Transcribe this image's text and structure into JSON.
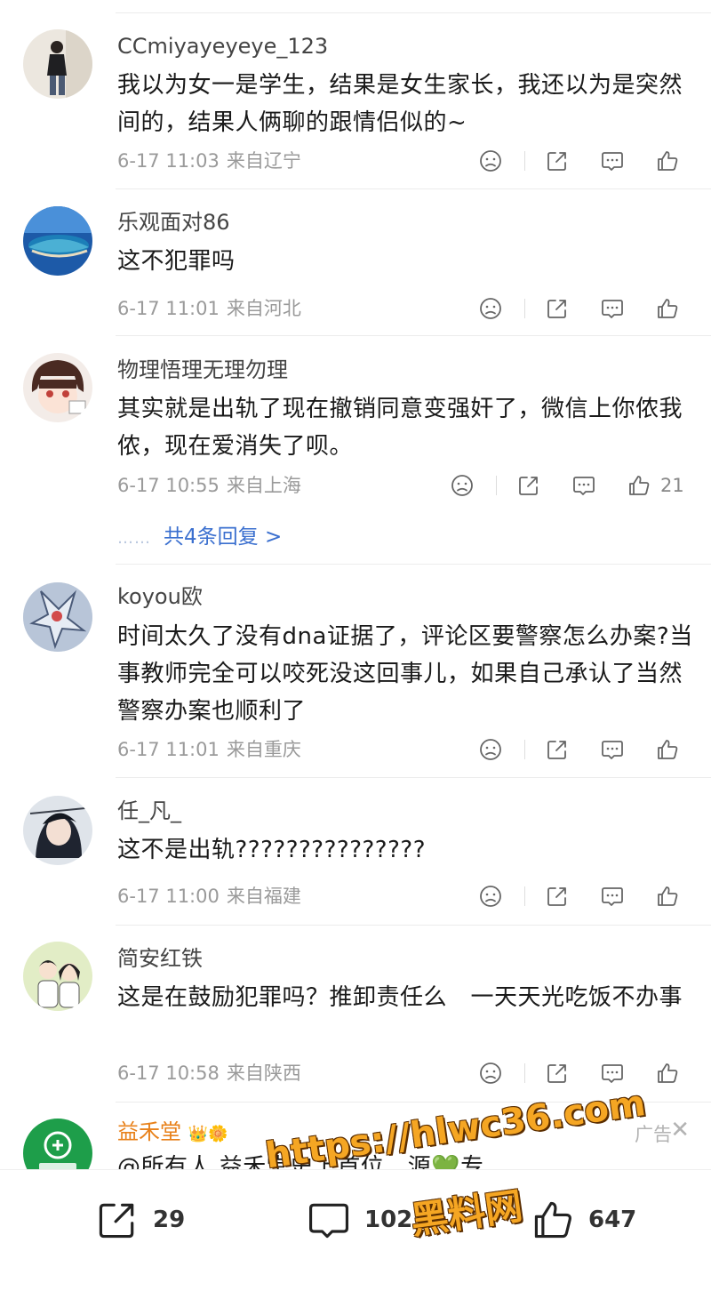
{
  "comments": [
    {
      "username": "CCmiyayeyeye_123",
      "text": "我以为女一是学生，结果是女生家长，我还以为是突然间的，结果人俩聊的跟情侣似的~",
      "time": "6-17 11:03",
      "location": "来自辽宁"
    },
    {
      "username": "乐观面对86",
      "text": "这不犯罪吗",
      "time": "6-17 11:01",
      "location": "来自河北"
    },
    {
      "username": "物理悟理无理勿理",
      "text": "其实就是出轨了现在撤销同意变强奸了，微信上你侬我侬，现在爱消失了呗。",
      "time": "6-17 10:55",
      "location": "来自上海",
      "likes": "21",
      "replies_dots": "……",
      "replies_label": "共4条回复 >"
    },
    {
      "username": "koyou欧",
      "text": "时间太久了没有dna证据了，评论区要警察怎么办案?当事教师完全可以咬死没这回事儿，如果自己承认了当然警察办案也顺利了",
      "time": "6-17 11:01",
      "location": "来自重庆"
    },
    {
      "username": "任_凡_",
      "text": "这不是出轨???????????????",
      "time": "6-17 11:00",
      "location": "来自福建"
    },
    {
      "username": "简安红铁",
      "text": "这是在鼓励犯罪吗？推卸责任么　一天天光吃饭不办事",
      "time": "6-17 10:58",
      "location": "来自陕西"
    }
  ],
  "ad": {
    "username": "益禾堂",
    "badges": "👑🌼",
    "text": "@所有人 益禾堂史上首位…源💚专",
    "tag": "广告",
    "close": "✕"
  },
  "bottom_bar": {
    "share_count": "29",
    "comment_count": "102",
    "like_count": "647"
  },
  "watermark": {
    "line1": "https://hlwc36.com",
    "line2": "黑料网"
  },
  "icons": [
    "dislike-icon",
    "share-icon",
    "comment-icon",
    "like-icon",
    "close-icon"
  ],
  "colors": {
    "link": "#3a6fcf",
    "ad_name": "#e8811a",
    "meta": "#9a9a9a",
    "watermark": "#f5a623"
  }
}
